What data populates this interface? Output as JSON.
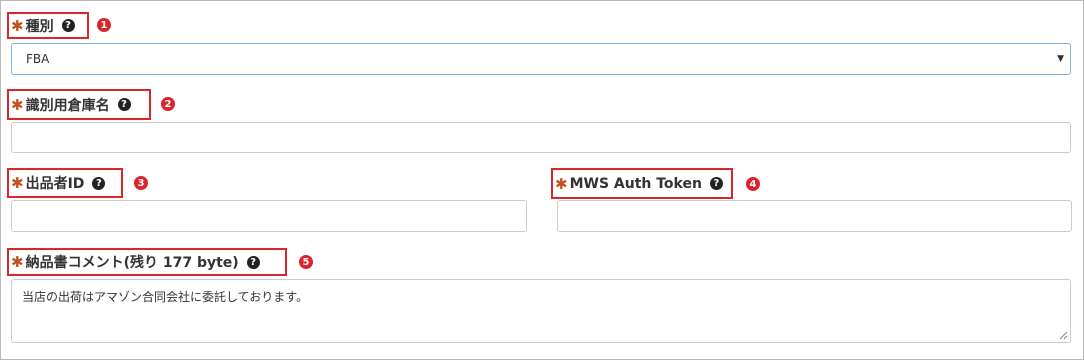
{
  "fields": {
    "type": {
      "label": "種別",
      "badge": "1",
      "selected": "FBA"
    },
    "warehouse_name": {
      "label": "識別用倉庫名",
      "badge": "2",
      "value": ""
    },
    "seller_id": {
      "label": "出品者ID",
      "badge": "3",
      "value": ""
    },
    "mws_token": {
      "label": "MWS Auth Token",
      "badge": "4",
      "value": ""
    },
    "delivery_comment": {
      "label": " 納品書コメント(残り 177 byte)",
      "badge": "5",
      "value": "当店の出荷はアマゾン合同会社に委託しております。"
    }
  },
  "icons": {
    "required": "asterisk-icon",
    "help": "question-circle-icon",
    "dropdown": "caret-down-icon",
    "resize": "resize-handle-icon"
  },
  "symbols": {
    "asterisk": "✱",
    "help": "?",
    "caret": "▼"
  },
  "colors": {
    "highlight_border": "#d9262c",
    "badge": "#d9262c",
    "required_asterisk": "#c0531b",
    "select_focus_border": "#7fb4dd"
  }
}
